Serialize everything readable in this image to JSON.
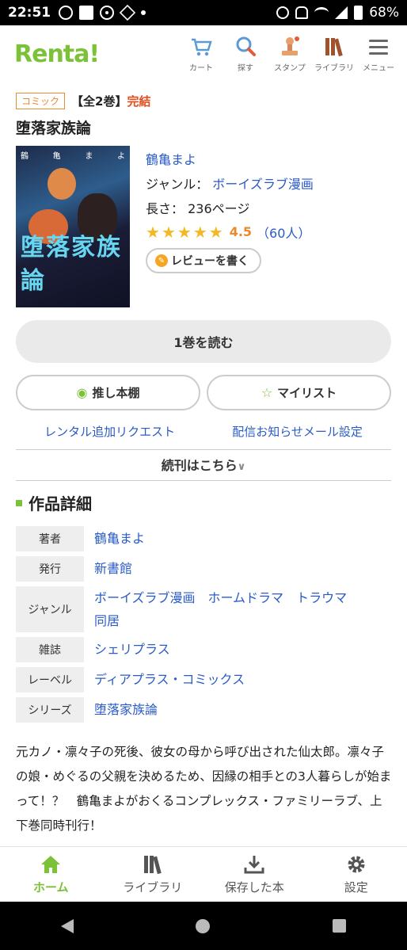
{
  "status": {
    "time": "22:51",
    "battery": "68%"
  },
  "header": {
    "logo": "Renta!",
    "nav": [
      {
        "label": "カート",
        "icon": "cart-icon"
      },
      {
        "label": "探す",
        "icon": "search-icon"
      },
      {
        "label": "スタンプ",
        "icon": "stamp-icon"
      },
      {
        "label": "ライブラリ",
        "icon": "library-icon"
      },
      {
        "label": "メニュー",
        "icon": "menu-icon"
      }
    ]
  },
  "book": {
    "category_tag": "コミック",
    "volumes": "【全2巻】",
    "status": "完結",
    "title": "堕落家族論",
    "cover_title": "堕落家族論",
    "cover_author": [
      "鶴",
      "亀",
      "ま",
      "よ"
    ],
    "author": "鶴亀まよ",
    "genre_label": "ジャンル：",
    "genre": "ボーイズラブ漫画",
    "length_label": "長さ：",
    "length": "236ページ",
    "rating": "4.5",
    "rating_count": "（60人）",
    "stars": 5,
    "review_button": "レビューを書く"
  },
  "actions": {
    "read_button": "1巻を読む",
    "shelf_button": "推し本棚",
    "mylist_button": "マイリスト",
    "rental_request": "レンタル追加リクエスト",
    "notify_setting": "配信お知らせメール設定",
    "continued": "続刊はこちら"
  },
  "details": {
    "heading": "作品詳細",
    "rows": [
      {
        "label": "著者",
        "values": [
          "鶴亀まよ"
        ]
      },
      {
        "label": "発行",
        "values": [
          "新書館"
        ]
      },
      {
        "label": "ジャンル",
        "values": [
          "ボーイズラブ漫画",
          "ホームドラマ",
          "トラウマ",
          "同居"
        ]
      },
      {
        "label": "雑誌",
        "values": [
          "シェリプラス"
        ]
      },
      {
        "label": "レーベル",
        "values": [
          "ディアプラス・コミックス"
        ]
      },
      {
        "label": "シリーズ",
        "values": [
          "堕落家族論"
        ]
      }
    ]
  },
  "description": "元カノ・凛々子の死後、彼女の母から呼び出された仙太郎。凛々子の娘・めぐるの父親を決めるため、因縁の相手との3人暮らしが始まって！？　鶴亀まよがおくるコンプレックス・ファミリーラブ、上下巻同時刊行！",
  "bottom_nav": [
    {
      "label": "ホーム",
      "icon": "home-icon",
      "active": true
    },
    {
      "label": "ライブラリ",
      "icon": "library-icon",
      "active": false
    },
    {
      "label": "保存した本",
      "icon": "download-icon",
      "active": false
    },
    {
      "label": "設定",
      "icon": "gear-icon",
      "active": false
    }
  ],
  "colors": {
    "brand": "#7bc238",
    "link": "#2a5bc8",
    "accent": "#e88a2e",
    "star": "#f5b823"
  }
}
